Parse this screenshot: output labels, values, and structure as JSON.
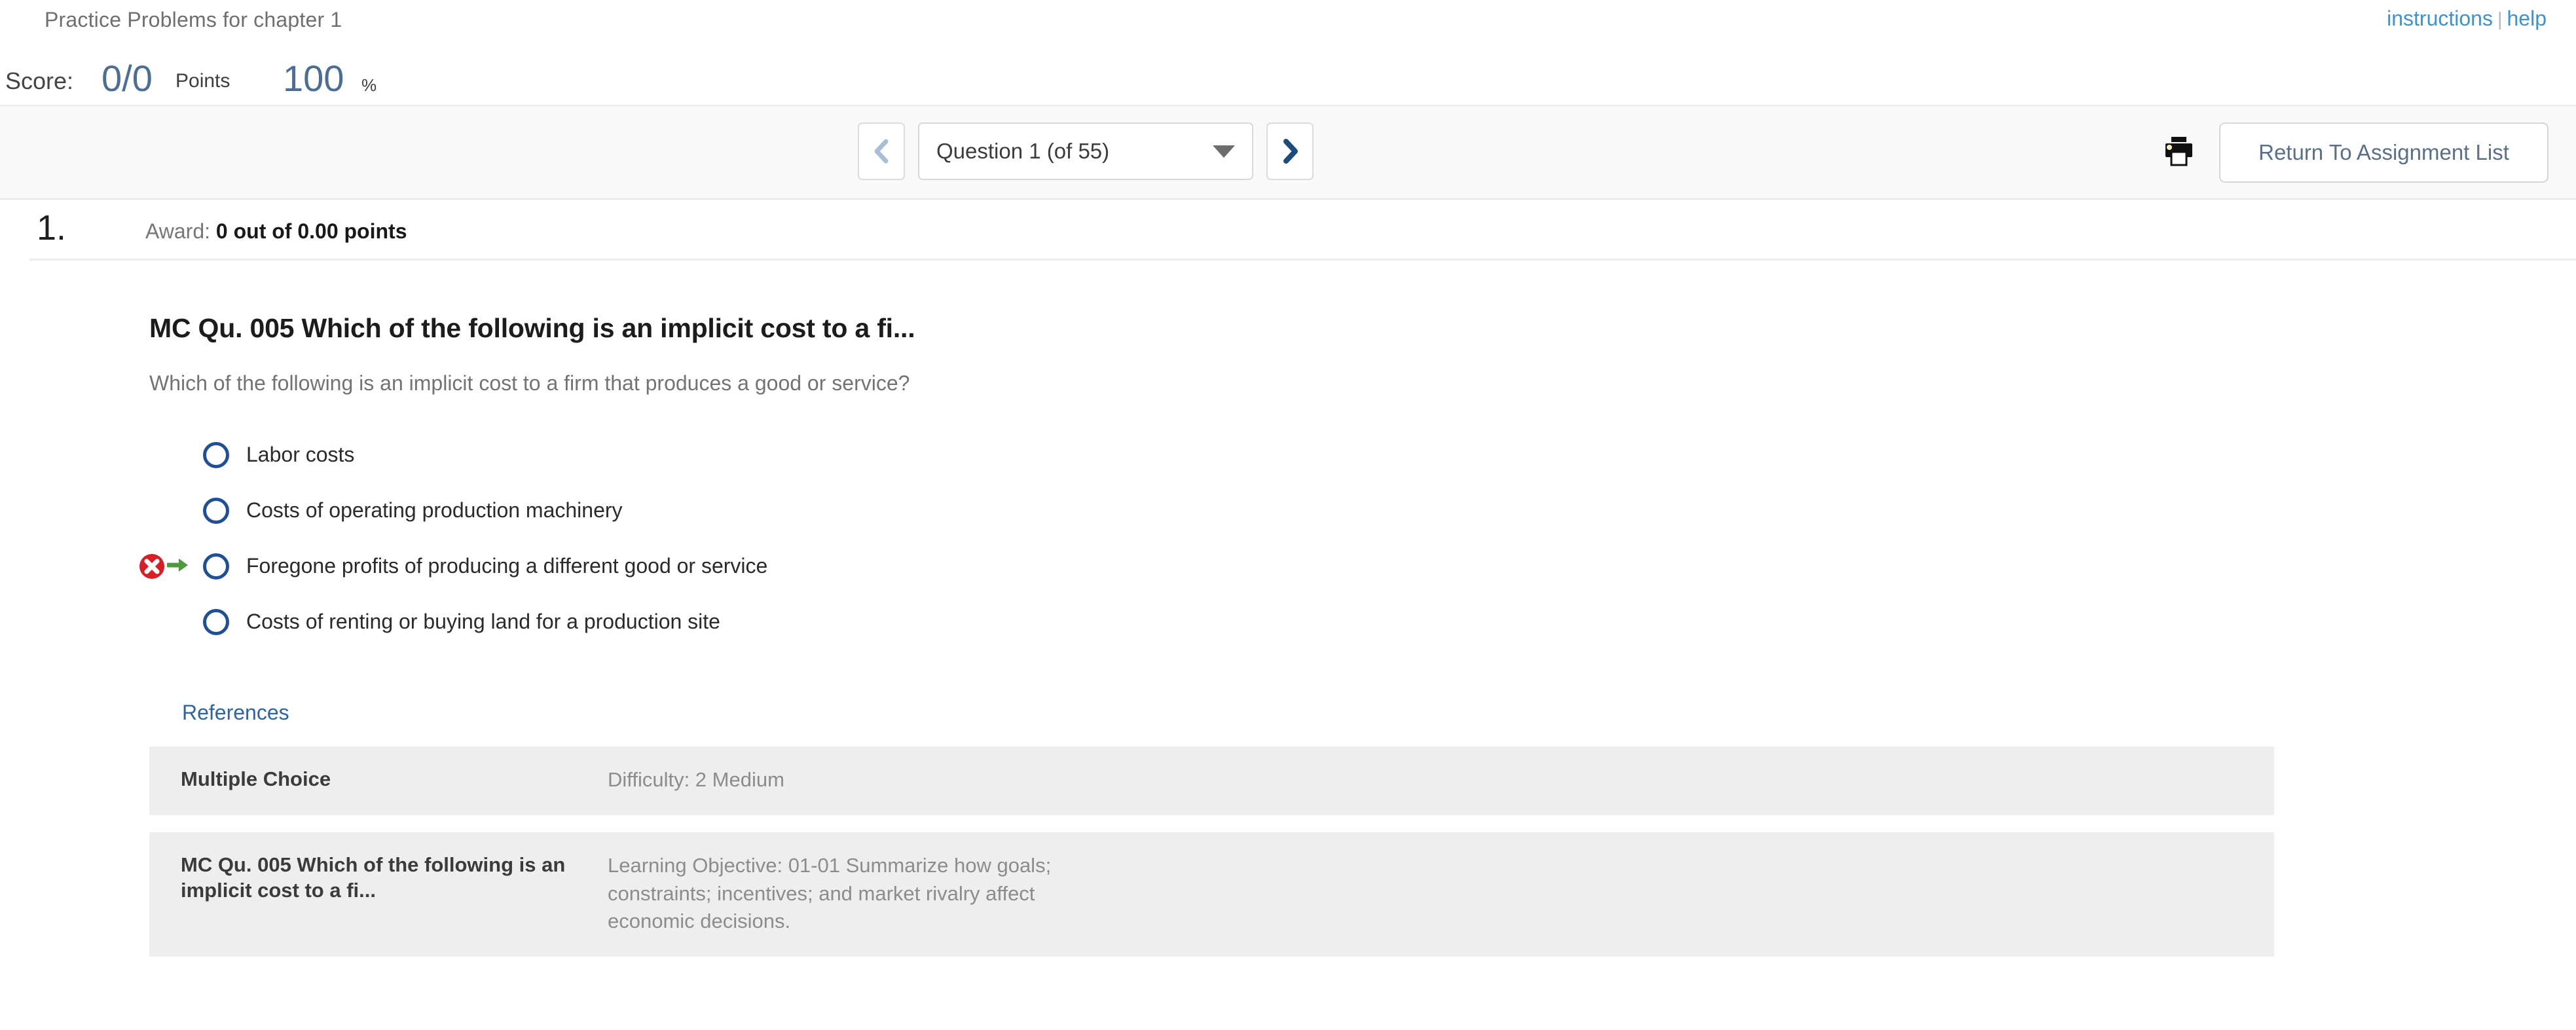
{
  "header": {
    "assignment_title": "Practice Problems for chapter 1",
    "instructions_link": "instructions",
    "link_separator": "|",
    "help_link": "help"
  },
  "score": {
    "label": "Score:",
    "points_value": "0/0",
    "points_unit": "Points",
    "percent_value": "100",
    "percent_unit": "%"
  },
  "nav": {
    "prev_icon": "chevron-left-icon",
    "next_icon": "chevron-right-icon",
    "question_selector": "Question 1 (of 55)",
    "dropdown_icon": "chevron-down-icon",
    "print_icon": "printer-icon",
    "return_button": "Return To Assignment List"
  },
  "question": {
    "number": "1.",
    "award_label": "Award:",
    "award_value": "0 out of 0.00 points",
    "heading": "MC Qu. 005 Which of the following is an implicit cost to a fi...",
    "stem": "Which of the following is an implicit cost to a firm that produces a good or service?",
    "choices": [
      {
        "label": "Labor costs",
        "marked_incorrect": false
      },
      {
        "label": "Costs of operating production machinery",
        "marked_incorrect": false
      },
      {
        "label": "Foregone profits of producing a different good or service",
        "marked_incorrect": true
      },
      {
        "label": "Costs of renting or buying land for a production site",
        "marked_incorrect": false
      }
    ]
  },
  "references": {
    "link_label": "References",
    "rows": [
      {
        "left": "Multiple Choice",
        "right": "Difficulty: 2 Medium"
      },
      {
        "left": "MC Qu. 005 Which of the following is an implicit cost to a fi...",
        "right": "Learning Objective: 01-01 Summarize how goals; constraints; incentives; and market rivalry affect economic decisions."
      }
    ]
  },
  "colors": {
    "link_blue": "#3b92d4",
    "score_blue": "#4a6e96",
    "radio_blue": "#1f4f96",
    "incorrect_red": "#d91f26",
    "arrow_green": "#4e9a3e",
    "reference_link_blue": "#2d64a8",
    "table_bg": "#eeeeee"
  }
}
